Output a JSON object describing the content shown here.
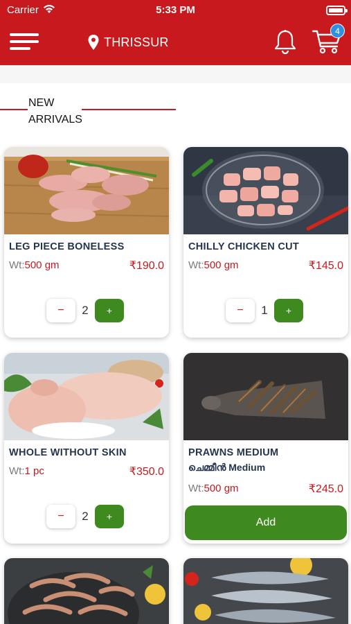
{
  "status_bar": {
    "carrier": "Carrier",
    "time": "5:33 PM"
  },
  "header": {
    "location": "THRISSUR",
    "cart_count": "4"
  },
  "section": {
    "title": "NEW ARRIVALS"
  },
  "currency": "₹",
  "products": [
    {
      "name": "LEG PIECE BONELESS",
      "wt_label": "Wt:",
      "wt_value": "500 gm",
      "price": "₹190.0",
      "minus": "−",
      "qty": "2",
      "plus": "+"
    },
    {
      "name": "CHILLY CHICKEN CUT",
      "wt_label": "Wt:",
      "wt_value": "500 gm",
      "price": "₹145.0",
      "minus": "−",
      "qty": "1",
      "plus": "+"
    },
    {
      "name": "WHOLE WITHOUT SKIN",
      "wt_label": "Wt:",
      "wt_value": "1 pc",
      "price": "₹350.0",
      "minus": "−",
      "qty": "2",
      "plus": "+"
    },
    {
      "name": "PRAWNS MEDIUM",
      "subtitle": "ചെമ്മീൻ Medium",
      "wt_label": "Wt:",
      "wt_value": "500 gm",
      "price": "₹245.0",
      "add_label": "Add"
    }
  ],
  "colors": {
    "brand_red": "#c8191f",
    "accent_green": "#3f8a1f",
    "badge_blue": "#2f8fe0",
    "name_navy": "#24344f"
  },
  "icons": [
    "wifi-icon",
    "battery-icon",
    "menu-icon",
    "location-pin-icon",
    "bell-icon",
    "cart-icon"
  ]
}
